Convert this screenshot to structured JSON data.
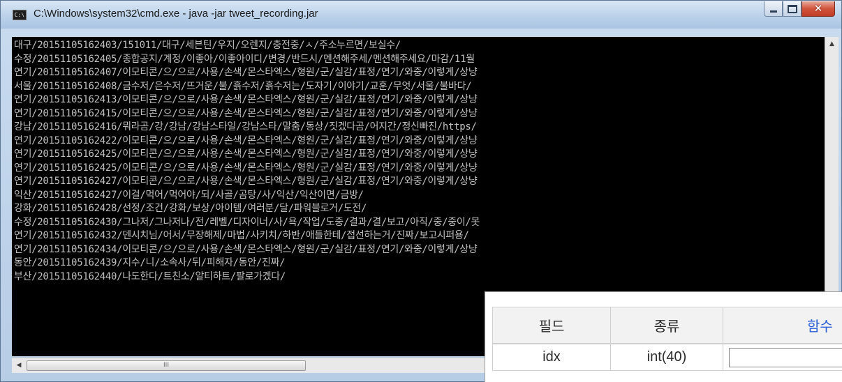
{
  "window": {
    "title": "C:\\Windows\\system32\\cmd.exe - java  -jar tweet_recording.jar",
    "app_icon_text": "C:\\"
  },
  "console": {
    "lines": [
      "대구/20151105162403/151011/대구/세븐틴/우지/오렌지/충전중/ㅅ/주소누르면/보실수/",
      "수정/20151105162405/종합공지/계정/이좋아/이좋아이디/변경/반드시/멘션해주세/멘션해주세요/마감/11월",
      "연기/20151105162407/이모티콘/으/으로/사용/손색/몬스타엑스/형원/군/실감/표정/연기/와중/이렇게/상냥",
      "서울/20151105162408/금수저/은수저/뜨거운/불/흙수저/흙수저는/도자기/이야기/교훈/무엇/서울/불바다/",
      "연기/20151105162413/이모티콘/으/으로/사용/손색/몬스타엑스/형원/군/실감/표정/연기/와중/이렇게/상냥",
      "연기/20151105162415/이모티콘/으/으로/사용/손색/몬스타엑스/형원/군/실감/표정/연기/와중/이렇게/상냥",
      "강남/20151105162416/뭐라곰/강/강남/강남스타일/강남스타/말춤/동상/짓겠다곰/어지간/정신빠진/https/",
      "연기/20151105162422/이모티콘/으/으로/사용/손색/몬스타엑스/형원/군/실감/표정/연기/와중/이렇게/상냥",
      "연기/20151105162425/이모티콘/으/으로/사용/손색/몬스타엑스/형원/군/실감/표정/연기/와중/이렇게/상냥",
      "연기/20151105162425/이모티콘/으/으로/사용/손색/몬스타엑스/형원/군/실감/표정/연기/와중/이렇게/상냥",
      "연기/20151105162427/이모티콘/으/으로/사용/손색/몬스타엑스/형원/군/실감/표정/연기/와중/이렇게/상냥",
      "익산/20151105162427/이걸/먹어/먹어야/되/사골/곰탕/사/익산/익산이면/금방/",
      "강화/20151105162428/선정/조건/강화/보상/아이템/여러분/달/파워블로거/도전/",
      "수정/20151105162430/그나저/그나저나/전/레벨/디자이너/사/욕/작업/도중/결과/결/보고/아직/중/중이/못",
      "연기/20151105162432/덴시치님/어서/무장해제/마법/사키치/하반/애들한테/접선하는거/진짜/보고시퍼용/",
      "연기/20151105162434/이모티콘/으/으로/사용/손색/몬스타엑스/형원/군/실감/표정/연기/와중/이렇게/상냥",
      "동안/20151105162439/지수/니/소속사/뒤/피해자/동안/진짜/",
      "부산/20151105162440/나도한다/트친소/알티하트/팔로가겠다/"
    ]
  },
  "scrollbar": {
    "up_arrow": "▲",
    "left_arrow": "◀",
    "thumb_grip": "III"
  },
  "field_table": {
    "headers": [
      "필드",
      "종류",
      "함수"
    ],
    "row": {
      "field": "idx",
      "type": "int(40)",
      "value": ""
    }
  }
}
